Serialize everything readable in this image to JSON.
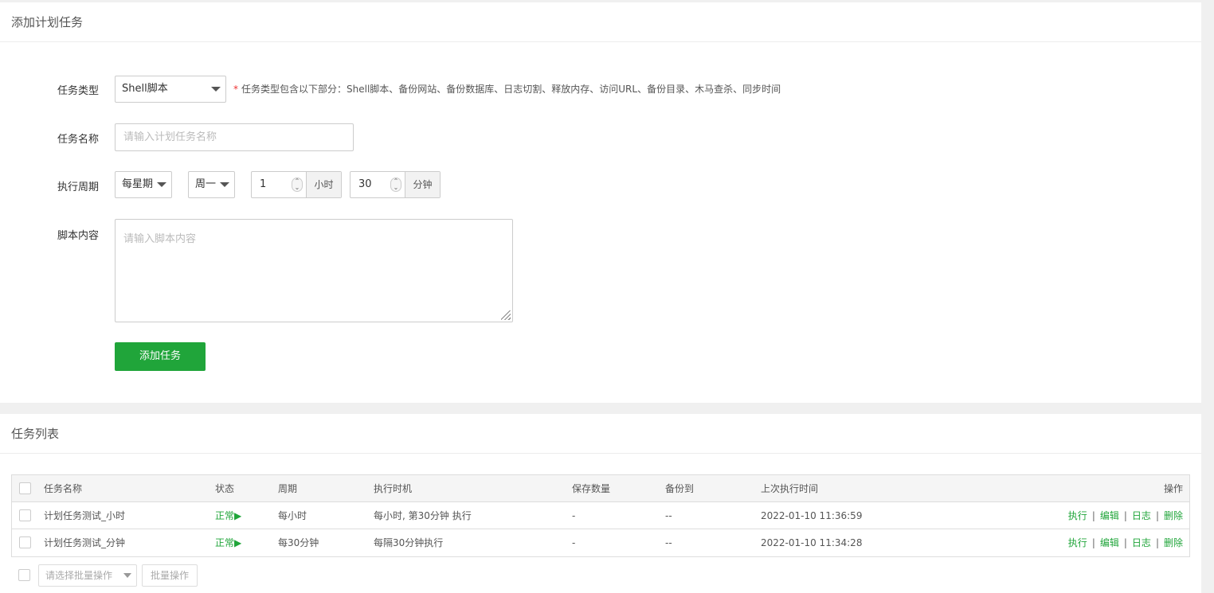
{
  "add_panel": {
    "title": "添加计划任务",
    "task_type_label": "任务类型",
    "task_type_value": "Shell脚本",
    "task_type_hint_required": "*",
    "task_type_hint": "任务类型包含以下部分：Shell脚本、备份网站、备份数据库、日志切割、释放内存、访问URL、备份目录、木马查杀、同步时间",
    "task_name_label": "任务名称",
    "task_name_placeholder": "请输入计划任务名称",
    "period_label": "执行周期",
    "period_type": "每星期",
    "weekday": "周一",
    "hour_value": "1",
    "hour_unit": "小时",
    "minute_value": "30",
    "minute_unit": "分钟",
    "script_label": "脚本内容",
    "script_placeholder": "请输入脚本内容",
    "submit_label": "添加任务"
  },
  "list_panel": {
    "title": "任务列表",
    "columns": [
      "任务名称",
      "状态",
      "周期",
      "执行时机",
      "保存数量",
      "备份到",
      "上次执行时间",
      "操作"
    ],
    "rows": [
      {
        "name": "计划任务测试_小时",
        "status": "正常▶",
        "period": "每小时",
        "timing": "每小时, 第30分钟 执行",
        "keep": "-",
        "backup_to": "--",
        "last_run": "2022-01-10 11:36:59",
        "ops": [
          "执行",
          "编辑",
          "日志",
          "删除"
        ]
      },
      {
        "name": "计划任务测试_分钟",
        "status": "正常▶",
        "period": "每30分钟",
        "timing": "每隔30分钟执行",
        "keep": "-",
        "backup_to": "--",
        "last_run": "2022-01-10 11:34:28",
        "ops": [
          "执行",
          "编辑",
          "日志",
          "删除"
        ]
      }
    ],
    "op_separator": "|",
    "batch_placeholder": "请选择批量操作",
    "batch_button": "批量操作"
  },
  "colors": {
    "accent": "#20a53a",
    "background": "#f0f0f0"
  }
}
